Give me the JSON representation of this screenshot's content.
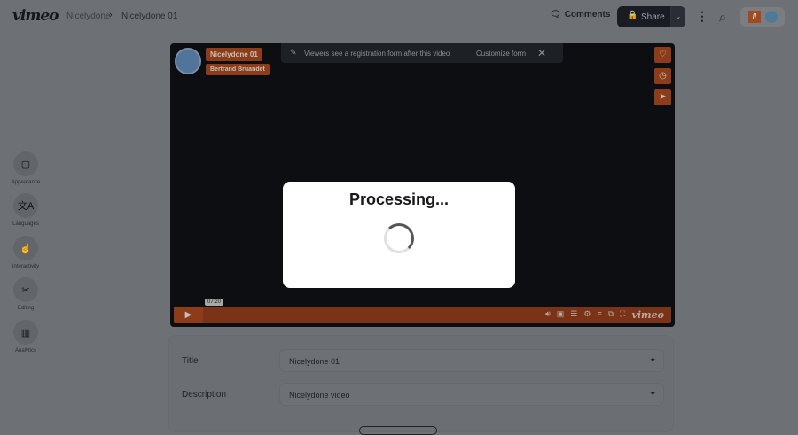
{
  "header": {
    "logo": "vimeo",
    "breadcrumb": [
      "Nicelydone",
      "Nicelydone 01"
    ],
    "comments_label": "Comments",
    "share_label": "Share",
    "avatar_initial": "//"
  },
  "sidebar": [
    {
      "label": "Appearance",
      "icon": "▢"
    },
    {
      "label": "Languages",
      "icon": "文A"
    },
    {
      "label": "Interactivity",
      "icon": "☝"
    },
    {
      "label": "Editing",
      "icon": "✂"
    },
    {
      "label": "Analytics",
      "icon": "▥"
    }
  ],
  "player": {
    "title": "Nicelydone 01",
    "author": "Bertrand Bruandet",
    "banner_text": "Viewers see a registration form after this video",
    "customize_label": "Customize form",
    "time": "07:20",
    "brand": "vimeo"
  },
  "modal": {
    "title": "Processing..."
  },
  "form": {
    "title_label": "Title",
    "title_value": "Nicelydone 01",
    "description_label": "Description",
    "description_value": "Nicelydone video"
  },
  "colors": {
    "accent": "#8c3c18",
    "dark": "#0c0e11"
  }
}
